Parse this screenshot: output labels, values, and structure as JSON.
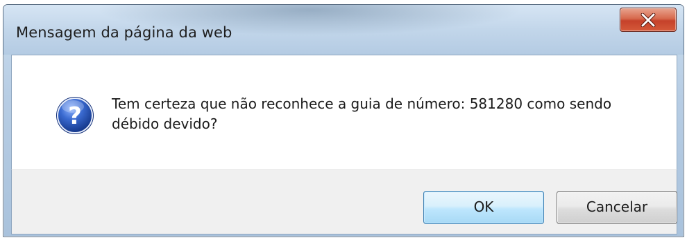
{
  "dialog": {
    "title": "Mensagem da página da web",
    "message": "Tem certeza que não reconhece a guia de número: 581280 como sendo débido devido?",
    "icon": "question-icon",
    "close_icon": "close-icon"
  },
  "buttons": {
    "ok_label": "OK",
    "cancel_label": "Cancelar"
  },
  "colors": {
    "titlebar": "#c2d6ea",
    "close_button": "#c5412a",
    "icon_blue": "#2a56b8",
    "footer": "#f0f0f0",
    "ok_button": "#bee6fd"
  }
}
